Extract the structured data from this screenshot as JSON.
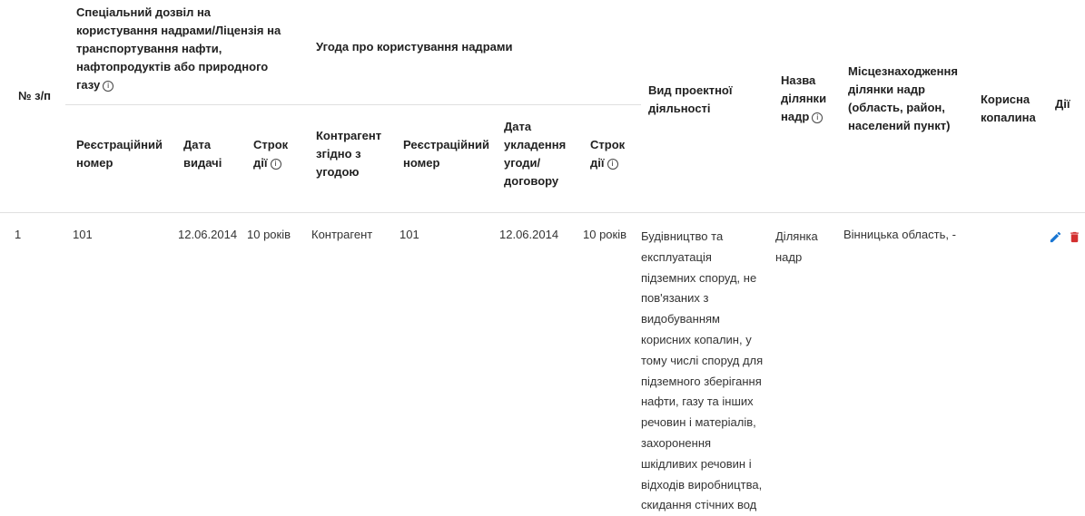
{
  "table": {
    "headers": {
      "number": "№ з/п",
      "permit_group": "Спеціальний дозвіл на користування надрами/Ліцензія на транспортування нафти, нафтопродуктів або природного газу",
      "agreement_group": "Угода про користування надрами",
      "permit_reg_number": "Реєстраційний номер",
      "permit_issue_date": "Дата видачі",
      "permit_term": "Строк дії",
      "agreement_counterparty": "Контрагент згідно з угодою",
      "agreement_reg_number": "Реєстраційний номер",
      "agreement_date": "Дата укладення угоди/ договору",
      "agreement_term": "Строк дії",
      "project_activity": "Вид проектної діяльності",
      "plot_name": "Назва ділянки надр",
      "plot_location": "Місцезнаходження ділянки надр (область, район, населений пункт)",
      "mineral": "Корисна копалина",
      "actions": "Дії"
    },
    "rows": [
      {
        "number": "1",
        "permit_reg_number": "101",
        "permit_issue_date": "12.06.2014",
        "permit_term": "10 років",
        "agreement_counterparty": "Контрагент",
        "agreement_reg_number": "101",
        "agreement_date": "12.06.2014",
        "agreement_term": "10 років",
        "project_activity": "Будівництво та експлуатація підземних споруд, не пов'язаних з видобуванням корисних копалин, у тому числі споруд для підземного зберігання нафти, газу та інших речовин і матеріалів, захоронення шкідливих речовин і відходів виробництва, скидання стічних вод",
        "plot_name": "Ділянка надр",
        "plot_location": "Вінницька область, -",
        "mineral": ""
      }
    ]
  },
  "icons": {
    "edit": "edit-pencil-icon",
    "delete": "delete-trash-icon",
    "info": "info-circle-icon"
  },
  "colors": {
    "edit": "#1976d2",
    "delete": "#d32f2f",
    "border": "#e0e0e0",
    "text": "#212121"
  }
}
